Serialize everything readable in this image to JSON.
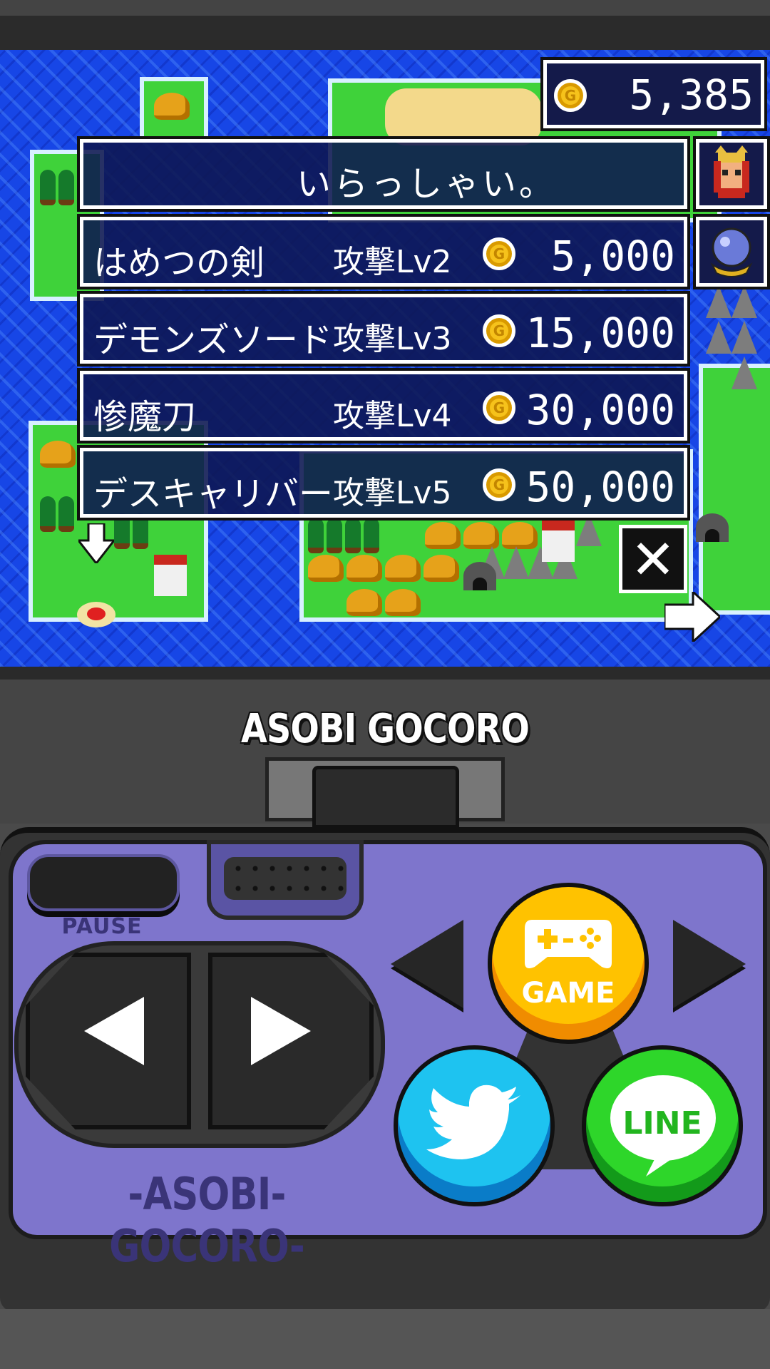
{
  "coins": {
    "value": "5,385"
  },
  "shop": {
    "greeting": "いらっしゃい。",
    "items": [
      {
        "name": "はめつの剣",
        "level": "攻撃Lv2",
        "price": "5,000"
      },
      {
        "name": "デモンズソード",
        "level": "攻撃Lv3",
        "price": "15,000"
      },
      {
        "name": "惨魔刀",
        "level": "攻撃Lv4",
        "price": "30,000"
      },
      {
        "name": "デスキャリバー",
        "level": "攻撃Lv5",
        "price": "50,000"
      }
    ],
    "close_label": "✕"
  },
  "console": {
    "brand_top": "ASOBI GOCORO",
    "brand_bottom": "-ASOBI-GOCORO-",
    "pause_label": "PAUSE",
    "game_label": "GAME",
    "line_label": "LINE"
  },
  "colors": {
    "sea": "#1746e6",
    "land": "#3fd23a",
    "panel": "#0e1650",
    "controller": "#7e75cc",
    "game_button": "#ffc200",
    "twitter_button": "#1ec3f0",
    "line_button": "#2ed62a"
  },
  "icons": [
    "coin-icon",
    "hero-portrait-icon",
    "crystal-ball-icon",
    "close-icon",
    "arrow-right-icon",
    "arrow-down-icon",
    "gamepad-icon",
    "twitter-bird-icon",
    "line-bubble-icon"
  ]
}
